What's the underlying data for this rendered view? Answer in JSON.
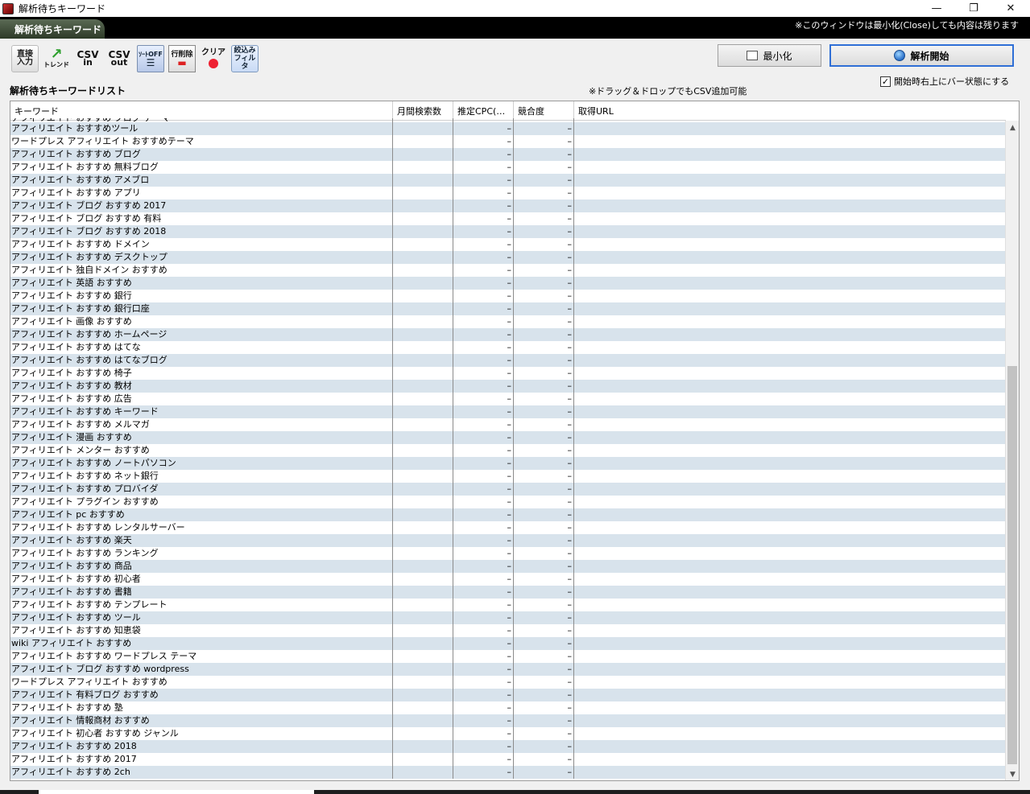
{
  "window": {
    "title": "解析待ちキーワード",
    "minimize_glyph": "—",
    "maximize_glyph": "❐",
    "close_glyph": "✕"
  },
  "banner": {
    "tab_label": "解析待ちキーワード",
    "notice": "※このウィンドウは最小化(Close)しても内容は残ります"
  },
  "toolbar": {
    "direct_line1": "直接",
    "direct_line2": "入力",
    "trend_label": "トレンド",
    "csv_in_top": "CSV",
    "csv_in_bottom": "in",
    "csv_out_top": "CSV",
    "csv_out_bottom": "out",
    "sort_off": "ｿｰﾄOFF",
    "row_delete": "行削除",
    "clear": "クリア",
    "filter_line1": "絞込み",
    "filter_line2": "フィルタ"
  },
  "buttons": {
    "minimize": "最小化",
    "start": "解析開始"
  },
  "checkbox": {
    "label": "開始時右上にバー状態にする",
    "checked": "✓"
  },
  "list": {
    "title": "解析待ちキーワードリスト",
    "dnd_note": "※ドラッグ＆ドロップでもCSV追加可能"
  },
  "table": {
    "columns": [
      "キーワード",
      "月間検索数",
      "推定CPC(…",
      "競合度",
      "取得URL"
    ],
    "partial_row": "アフィリエイト おすすめ ブログ テーマ",
    "rows": [
      "アフィリエイト おすすめツール",
      "ワードプレス アフィリエイト おすすめテーマ",
      "アフィリエイト おすすめ ブログ",
      "アフィリエイト おすすめ 無料ブログ",
      "アフィリエイト おすすめ アメブロ",
      "アフィリエイト おすすめ アプリ",
      "アフィリエイト ブログ おすすめ 2017",
      "アフィリエイト ブログ おすすめ 有料",
      "アフィリエイト ブログ おすすめ 2018",
      "アフィリエイト おすすめ ドメイン",
      "アフィリエイト おすすめ デスクトップ",
      "アフィリエイト 独自ドメイン おすすめ",
      "アフィリエイト 英語 おすすめ",
      "アフィリエイト おすすめ 銀行",
      "アフィリエイト おすすめ 銀行口座",
      "アフィリエイト 画像 おすすめ",
      "アフィリエイト おすすめ ホームページ",
      "アフィリエイト おすすめ はてな",
      "アフィリエイト おすすめ はてなブログ",
      "アフィリエイト おすすめ 椅子",
      "アフィリエイト おすすめ 教材",
      "アフィリエイト おすすめ 広告",
      "アフィリエイト おすすめ キーワード",
      "アフィリエイト おすすめ メルマガ",
      "アフィリエイト 漫画 おすすめ",
      "アフィリエイト メンター おすすめ",
      "アフィリエイト おすすめ ノートパソコン",
      "アフィリエイト おすすめ ネット銀行",
      "アフィリエイト おすすめ プロバイダ",
      "アフィリエイト プラグイン おすすめ",
      "アフィリエイト pc おすすめ",
      "アフィリエイト おすすめ レンタルサーバー",
      "アフィリエイト おすすめ 楽天",
      "アフィリエイト おすすめ ランキング",
      "アフィリエイト おすすめ 商品",
      "アフィリエイト おすすめ 初心者",
      "アフィリエイト おすすめ 書籍",
      "アフィリエイト おすすめ テンプレート",
      "アフィリエイト おすすめ ツール",
      "アフィリエイト おすすめ 知恵袋",
      "wiki アフィリエイト おすすめ",
      "アフィリエイト おすすめ ワードプレス テーマ",
      "アフィリエイト ブログ おすすめ wordpress",
      "ワードプレス アフィリエイト おすすめ",
      "アフィリエイト 有料ブログ おすすめ",
      "アフィリエイト おすすめ 塾",
      "アフィリエイト 情報商材 おすすめ",
      "アフィリエイト 初心者 おすすめ ジャンル",
      "アフィリエイト おすすめ 2018",
      "アフィリエイト おすすめ 2017",
      "アフィリエイト おすすめ 2ch"
    ],
    "cpc_value": "–",
    "competition_value": "–"
  },
  "scrollbar": {
    "up_glyph": "▲",
    "down_glyph": "▼"
  }
}
